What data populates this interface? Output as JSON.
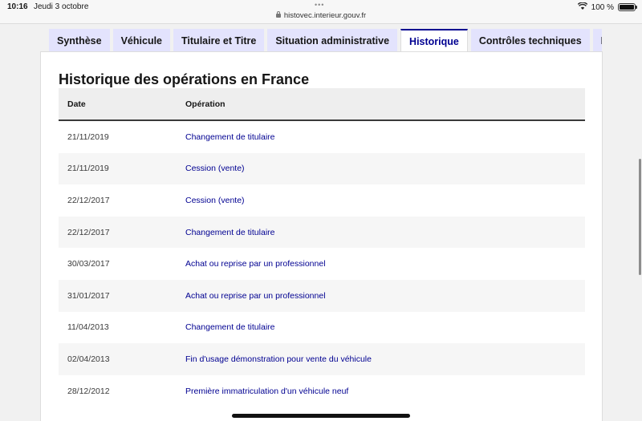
{
  "status_bar": {
    "time": "10:16",
    "date": "Jeudi 3 octobre",
    "url": "histovec.interieur.gouv.fr",
    "battery_text": "100 %",
    "battery_level_percent": 100
  },
  "tabs": [
    {
      "label": "Synthèse",
      "active": false
    },
    {
      "label": "Véhicule",
      "active": false
    },
    {
      "label": "Titulaire et Titre",
      "active": false
    },
    {
      "label": "Situation administrative",
      "active": false
    },
    {
      "label": "Historique",
      "active": true
    },
    {
      "label": "Contrôles techniques",
      "active": false
    },
    {
      "label": "Kilo",
      "active": false
    }
  ],
  "section": {
    "title": "Historique des opérations en France"
  },
  "table": {
    "headers": {
      "date": "Date",
      "operation": "Opération"
    },
    "rows": [
      {
        "date": "21/11/2019",
        "operation": "Changement de titulaire"
      },
      {
        "date": "21/11/2019",
        "operation": "Cession (vente)"
      },
      {
        "date": "22/12/2017",
        "operation": "Cession (vente)"
      },
      {
        "date": "22/12/2017",
        "operation": "Changement de titulaire"
      },
      {
        "date": "30/03/2017",
        "operation": "Achat ou reprise par un professionnel"
      },
      {
        "date": "31/01/2017",
        "operation": "Achat ou reprise par un professionnel"
      },
      {
        "date": "11/04/2013",
        "operation": "Changement de titulaire"
      },
      {
        "date": "02/04/2013",
        "operation": "Fin d'usage démonstration pour vente du véhicule"
      },
      {
        "date": "28/12/2012",
        "operation": "Première immatriculation d'un véhicule neuf"
      }
    ]
  },
  "colors": {
    "accent": "#000091",
    "tab_background": "#e3e3fd",
    "header_background": "#eeeeee"
  }
}
